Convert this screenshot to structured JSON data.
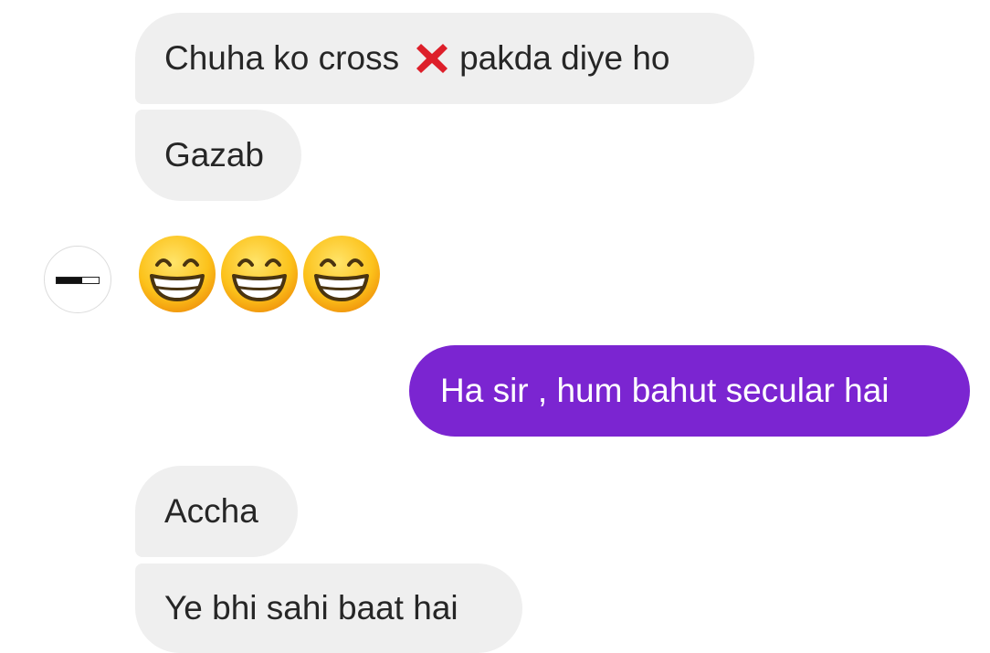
{
  "messages": {
    "m1": {
      "text_before": "Chuha ko cross",
      "icon": "cross-mark-icon",
      "text_after": "pakda diye ho"
    },
    "m2": {
      "text": "Gazab"
    },
    "m3": {
      "emojis": [
        "beaming-face-icon",
        "beaming-face-icon",
        "beaming-face-icon"
      ]
    },
    "m4": {
      "text": "Ha sir , hum bahut secular hai"
    },
    "m5": {
      "text": "Accha"
    },
    "m6": {
      "text": "Ye bhi sahi baat hai"
    }
  },
  "colors": {
    "incoming_bubble": "#efefef",
    "incoming_text": "#262626",
    "outgoing_bubble": "#7b25d1",
    "outgoing_text": "#ffffff",
    "cross_mark": "#dd1f2a"
  }
}
